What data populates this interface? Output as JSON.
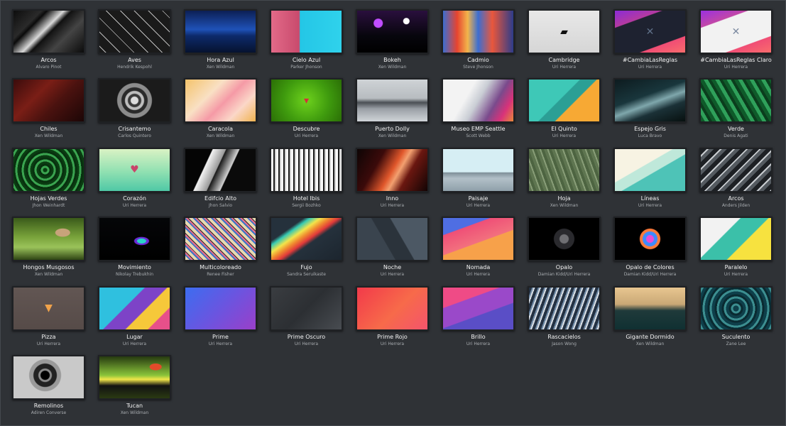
{
  "wallpapers": [
    {
      "title": "Arcos",
      "author": "Alvaro Pinot",
      "bg": "linear-gradient(135deg,#0d0d0d 0%,#2a2a2a 25%,#0a0a0a 30%,#d9d9d9 45%,#111 52%,#444 70%,#0b0b0b 100%)",
      "glyph": "",
      "glyph_color": ""
    },
    {
      "title": "Aves",
      "author": "Hendrik Kespohl",
      "bg": "repeating-linear-gradient(45deg,#1a1a1a 0 6px,#bdbdbd 6px 7px,#1a1a1a 7px 14px)",
      "glyph": "",
      "glyph_color": ""
    },
    {
      "title": "Hora Azul",
      "author": "Xen Wildman",
      "bg": "linear-gradient(180deg,#0c1f55 0%,#1f52b8 45%,#0d2a6b 60%,#06132f 100%)",
      "glyph": "",
      "glyph_color": ""
    },
    {
      "title": "Cielo Azul",
      "author": "Parker Jhonson",
      "bg": "linear-gradient(90deg,#e36a88 0%,#c84a6d 40%,#24c6e6 41%,#2fd2ec 100%)",
      "glyph": "",
      "glyph_color": ""
    },
    {
      "title": "Bokeh",
      "author": "Xen Wildman",
      "bg": "radial-gradient(circle at 30% 30%,#c04dff 0 6px,transparent 7px),radial-gradient(circle at 70% 25%,#ffffff 0 4px,transparent 5px),linear-gradient(180deg,#2a0f3d 0%,#07060d 60%,#000 100%)",
      "glyph": "",
      "glyph_color": ""
    },
    {
      "title": "Cadmio",
      "author": "Steve Jhonson",
      "bg": "linear-gradient(90deg,#3c6ed1 0%,#e7442f 20%,#f2b54b 35%,#3c6ed1 50%,#e9573c 70%,#2d3c8a 100%)",
      "glyph": "",
      "glyph_color": ""
    },
    {
      "title": "Cambridge",
      "author": "Uri Herrera",
      "bg": "linear-gradient(180deg,#e8e8e8,#d6d6d6)",
      "glyph": "▰",
      "glyph_color": "#111111"
    },
    {
      "title": "#CambiaLasReglas",
      "author": "Uri Herrera",
      "bg": "linear-gradient(160deg,#8b2bd6 0%,#b43aa0 25%,#1e2230 26%,#1e2230 75%,#f04d75 76%,#f96c6c 100%)",
      "glyph": "✕",
      "glyph_color": "#5f7088"
    },
    {
      "title": "#CambiaLasReglas Claro",
      "author": "Uri Herrera",
      "bg": "linear-gradient(160deg,#9b30e0 0%,#c247a8 25%,#f2f2f2 26%,#f2f2f2 75%,#f04d75 76%,#f96c6c 100%)",
      "glyph": "✕",
      "glyph_color": "#7c8aa0"
    },
    {
      "title": "Chiles",
      "author": "Xen Wildman",
      "bg": "linear-gradient(135deg,#3b0c0c 0%,#7a1e16 35%,#4a120f 60%,#1c0606 100%)",
      "glyph": "",
      "glyph_color": ""
    },
    {
      "title": "Crisantemo",
      "author": "Carlos Quintero",
      "bg": "radial-gradient(circle at 50% 50%,#dcdcdc 0 5px,#3a3a3a 6px 9px,#bdbdbd 10px 13px,#2a2a2a 14px 18px,#8c8c8c 19px 24px,#1b1b1b 25px 60px)",
      "glyph": "",
      "glyph_color": ""
    },
    {
      "title": "Caracola",
      "author": "Xen Wildman",
      "bg": "linear-gradient(135deg,#f4c36b 0%,#f9e0c4 35%,#f59aa6 55%,#fbd7c8 75%,#f0b34f 100%)",
      "glyph": "",
      "glyph_color": ""
    },
    {
      "title": "Descubre",
      "author": "Uri Herrera",
      "bg": "radial-gradient(circle at 50% 50%,#6ed21d 0%,#3f9b0e 55%,#2b6f06 100%)",
      "glyph": "▾",
      "glyph_color": "#d62e3b"
    },
    {
      "title": "Puerto Dolly",
      "author": "Xen Wildman",
      "bg": "linear-gradient(180deg,#cfd3d6 0%,#b7bcc0 45%,#4a4f54 55%,#9aa0a6 70%,#d0d4d8 100%)",
      "glyph": "",
      "glyph_color": ""
    },
    {
      "title": "Museo EMP Seattle",
      "author": "Scott Webb",
      "bg": "linear-gradient(120deg,#f3f3f3 0%,#f3f3f3 35%,#c9cdd4 50%,#7a4a8c 70%,#d8327a 85%,#e7893a 100%)",
      "glyph": "",
      "glyph_color": ""
    },
    {
      "title": "El Quinto",
      "author": "Uri Herrera",
      "bg": "linear-gradient(135deg,#3ec8b7 0%,#3ec8b7 45%,#2b9f95 46%,#2b9f95 60%,#f7a934 61%,#f7a934 100%)",
      "glyph": "",
      "glyph_color": ""
    },
    {
      "title": "Espejo Gris",
      "author": "Luca Bravo",
      "bg": "linear-gradient(160deg,#0d1b1f 0%,#19363c 40%,#7fa7ac 55%,#1b3137 70%,#07100f 100%)",
      "glyph": "",
      "glyph_color": ""
    },
    {
      "title": "Verde",
      "author": "Denis Agati",
      "bg": "repeating-linear-gradient(60deg,#0f5a2a 0 5px,#2fa05a 5px 10px,#0b3d1d 10px 14px)",
      "glyph": "",
      "glyph_color": ""
    },
    {
      "title": "Hojas Verdes",
      "author": "Jhon Weinhardt",
      "bg": "repeating-radial-gradient(circle at 45% 50%,#0a3c12 0 3px,#3aa34f 3px 6px,#08300f 6px 9px)",
      "glyph": "",
      "glyph_color": ""
    },
    {
      "title": "Corazón",
      "author": "Uri Herrera",
      "bg": "linear-gradient(180deg,#d9f2c4 0%,#8fe0b1 55%,#4fc8a6 100%)",
      "glyph": "♥",
      "glyph_color": "#c9446a"
    },
    {
      "title": "Edifcio Alto",
      "author": "Jhon Salvio",
      "bg": "linear-gradient(115deg,#050505 0%,#050505 30%,#f2f2f2 31%,#9a9a9a 45%,#1a1a1a 46%,#d0d0d0 60%,#0a0a0a 61%,#0a0a0a 100%)",
      "glyph": "",
      "glyph_color": ""
    },
    {
      "title": "Hotel Ibis",
      "author": "Sergii Bozhko",
      "bg": "repeating-linear-gradient(90deg,#fafafa 0 3px,#1a1a1a 3px 5px,#cfcfcf 5px 7px)",
      "glyph": "",
      "glyph_color": ""
    },
    {
      "title": "Inno",
      "author": "Uri Herrera",
      "bg": "linear-gradient(120deg,#0d0505 0%,#3b0a0a 30%,#e0572b 50%,#f3a070 58%,#6a1710 70%,#120404 100%)",
      "glyph": "",
      "glyph_color": ""
    },
    {
      "title": "Paisaje",
      "author": "Uri Herrera",
      "bg": "linear-gradient(180deg,#d6eef4 0%,#d6eef4 55%,#7e8e98 56%,#b2c0c8 70%,#8fa0aa 100%)",
      "glyph": "",
      "glyph_color": ""
    },
    {
      "title": "Hoja",
      "author": "Xen Wildman",
      "bg": "repeating-linear-gradient(70deg,#5e7550 0 4px,#889d77 4px 6px,#4d6441 6px 10px)",
      "glyph": "",
      "glyph_color": ""
    },
    {
      "title": "Líneas",
      "author": "Uri Herrera",
      "bg": "linear-gradient(150deg,#f7f3e3 0%,#f7f3e3 40%,#bfe8da 41%,#bfe8da 55%,#4ec3b7 56%,#4ec3b7 100%)",
      "glyph": "",
      "glyph_color": ""
    },
    {
      "title": "Arcos",
      "author": "Anders Jilden",
      "bg": "repeating-linear-gradient(135deg,#1d2024 0 6px,#c8ccd0 6px 8px,#545a60 8px 13px)",
      "glyph": "",
      "glyph_color": ""
    },
    {
      "title": "Hongos Musgosos",
      "author": "Xen Wildman",
      "bg": "radial-gradient(ellipse at 70% 35%,#c7a37a 0 10px,transparent 11px),linear-gradient(180deg,#3a5a1a 0%,#78a23a 45%,#9ac25a 70%,#2e4414 100%)",
      "glyph": "",
      "glyph_color": ""
    },
    {
      "title": "Movimiento",
      "author": "Nikolay Trebukhin",
      "bg": "radial-gradient(ellipse at 60% 55%,#2ad3c9 0 6px,#6a2ad3 7px 10px,transparent 11px),linear-gradient(180deg,#050608,#000)",
      "glyph": "",
      "glyph_color": ""
    },
    {
      "title": "Multicoloreado",
      "author": "Renee Fisher",
      "bg": "repeating-linear-gradient(45deg,#e8d9b0 0 4px,#3a74c9 4px 6px,#e86e8e 6px 8px,#2b2b2b 8px 9px)",
      "glyph": "",
      "glyph_color": ""
    },
    {
      "title": "Fujo",
      "author": "Sandra Seruikaste",
      "bg": "linear-gradient(145deg,#25313c 0%,#25313c 25%,#36c9b3 30%,#f2e44b 38%,#f08a2f 45%,#e13a3a 52%,#25313c 58%,#1c252e 100%)",
      "glyph": "",
      "glyph_color": ""
    },
    {
      "title": "Noche",
      "author": "Uri Herrera",
      "bg": "linear-gradient(60deg,#3a444e 0%,#3a444e 40%,#2b333b 41%,#2b333b 60%,#4c5864 61%,#4c5864 100%)",
      "glyph": "",
      "glyph_color": ""
    },
    {
      "title": "Nomada",
      "author": "Uri Herrera",
      "bg": "linear-gradient(160deg,#4f6ee3 0%,#4f6ee3 25%,#ef4f77 26%,#f2707e 55%,#f7a14a 56%,#f7a14a 100%)",
      "glyph": "",
      "glyph_color": ""
    },
    {
      "title": "Opalo",
      "author": "Damian Kidd/Uri Herrera",
      "bg": "radial-gradient(circle at 50% 50%,#6f6f73 0 6px,#2a2a2e 7px 14px,#000 15px)",
      "glyph": "",
      "glyph_color": ""
    },
    {
      "title": "Opalo de Colores",
      "author": "Damian Kidd/Uri Herrera",
      "bg": "radial-gradient(circle at 50% 50%,#e84bd6 0 5px,#3d8bff 6px 10px,#ff7a3a 11px 14px,#000 15px)",
      "glyph": "",
      "glyph_color": ""
    },
    {
      "title": "Paralelo",
      "author": "Uri Herrera",
      "bg": "linear-gradient(135deg,#f2f2f2 0%,#f2f2f2 35%,#3bc0a9 36%,#3bc0a9 60%,#f7e23f 61%,#f7e23f 100%)",
      "glyph": "",
      "glyph_color": ""
    },
    {
      "title": "Pizza",
      "author": "Uri Herrera",
      "bg": "linear-gradient(180deg,#625653,#564b48)",
      "glyph": "▼",
      "glyph_color": "#f0a24a"
    },
    {
      "title": "Lugar",
      "author": "Uri Herrera",
      "bg": "linear-gradient(135deg,#2fc0df 0%,#2fc0df 40%,#7d43c7 41%,#7d43c7 60%,#f6c83a 61%,#f6c83a 80%,#e7508a 81%,#e7508a 100%)",
      "glyph": "",
      "glyph_color": ""
    },
    {
      "title": "Prime",
      "author": "Uri Herrera",
      "bg": "linear-gradient(135deg,#3c6df0 0%,#6a55e0 50%,#9a3fc9 100%)",
      "glyph": "",
      "glyph_color": ""
    },
    {
      "title": "Prime Oscuro",
      "author": "Uri Herrera",
      "bg": "linear-gradient(135deg,#3a3d41 0%,#2c2f33 50%,#484c51 100%)",
      "glyph": "",
      "glyph_color": ""
    },
    {
      "title": "Prime Rojo",
      "author": "Uri Herrera",
      "bg": "linear-gradient(135deg,#f23a4a 0%,#f76a4a 55%,#f4546c 100%)",
      "glyph": "",
      "glyph_color": ""
    },
    {
      "title": "Brillo",
      "author": "Uri Herrera",
      "bg": "linear-gradient(160deg,#ef4b86 0%,#ef4b86 30%,#9a49c9 31%,#9a49c9 60%,#5a4ec6 61%,#5a4ec6 100%)",
      "glyph": "",
      "glyph_color": ""
    },
    {
      "title": "Rascacielos",
      "author": "Jason Wong",
      "bg": "repeating-linear-gradient(110deg,#243142 0 4px,#6f8aa6 4px 6px,#d9dee4 6px 8px)",
      "glyph": "",
      "glyph_color": ""
    },
    {
      "title": "Gigante Dormido",
      "author": "Xen Wildman",
      "bg": "linear-gradient(180deg,#e8c690 0%,#c9a876 40%,#1f3a3a 55%,#103032 100%)",
      "glyph": "",
      "glyph_color": ""
    },
    {
      "title": "Suculento",
      "author": "Zane Lee",
      "bg": "repeating-radial-gradient(circle at 50% 50%,#0e3f4a 0 4px,#3c8e90 4px 7px,#0a2a31 7px 10px)",
      "glyph": "",
      "glyph_color": ""
    },
    {
      "title": "Remolinos",
      "author": "Adiren Converse",
      "bg": "radial-gradient(circle at 45% 45%,#000 0 6px,#8a8a8a 7px 9px,#222 10px 16px,#9a9a9a 17px 22px,#c9c9c9 23px 60px)",
      "glyph": "",
      "glyph_color": ""
    },
    {
      "title": "Tucan",
      "author": "Xen Wildman",
      "bg": "radial-gradient(ellipse at 80% 25%,#e24b2a 0 8px,transparent 9px),linear-gradient(180deg,#263a10 0%,#8ac33a 45%,#f2e64a 55%,#121212 70%,#2a3a12 100%)",
      "glyph": "",
      "glyph_color": ""
    }
  ]
}
